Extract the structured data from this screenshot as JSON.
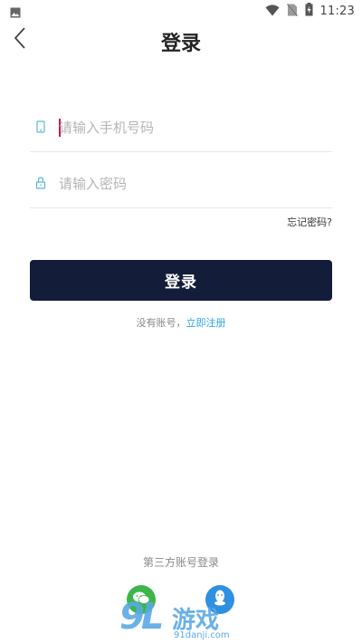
{
  "status_bar": {
    "time": "11:23",
    "icons": [
      "image-icon",
      "wifi-icon",
      "no-sim-icon",
      "battery-charging-icon"
    ]
  },
  "header": {
    "back_icon": "chevron-left-icon",
    "title": "登录"
  },
  "form": {
    "phone": {
      "icon": "phone-icon",
      "placeholder": "请输入手机号码",
      "value": ""
    },
    "password": {
      "icon": "lock-icon",
      "placeholder": "请输入密码",
      "value": ""
    },
    "forgot_label": "忘记密码?",
    "login_label": "登录"
  },
  "register": {
    "prompt": "没有账号，",
    "link": "立即注册"
  },
  "third_party": {
    "title": "第三方账号登录",
    "providers": [
      "wechat-icon",
      "qq-icon"
    ]
  },
  "watermark": {
    "logo": "9L",
    "text": "游戏",
    "site": "91danji.com"
  },
  "colors": {
    "primary_button": "#131d3a",
    "link": "#2ea7e0",
    "caret": "#c2185b",
    "icon_accent": "#5bb8d8"
  }
}
